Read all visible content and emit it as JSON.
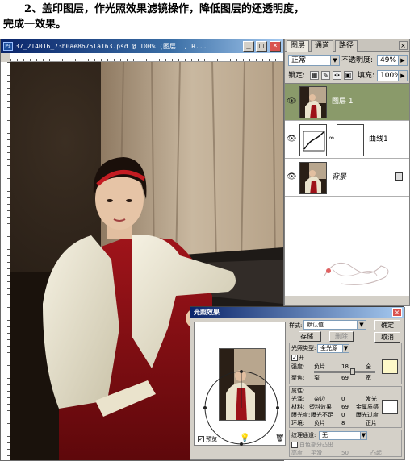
{
  "caption": {
    "line1": "2、盖印图层，作光照效果滤镜操作，降低图层的还透明度，",
    "line2": "完成一效果。"
  },
  "document": {
    "app_badge": "Ps",
    "title": "37_214016_73b0ae8675la163.psd @ 100% (图层 1, R...",
    "buttons": {
      "minimize": "_",
      "maximize": "□",
      "close": "×"
    }
  },
  "layers_panel": {
    "tabs": [
      "图层",
      "通道",
      "路径"
    ],
    "close": "×",
    "blend_mode": "正常",
    "opacity_label": "不透明度:",
    "opacity_value": "49%",
    "lock_label": "锁定:",
    "fill_label": "填充:",
    "fill_value": "100%",
    "layers": [
      {
        "name": "图层 1",
        "visible": true,
        "active": true
      },
      {
        "name": "曲线1",
        "visible": true,
        "active": false
      },
      {
        "name": "背景",
        "visible": true,
        "active": false,
        "locked": true
      }
    ]
  },
  "lighting_dialog": {
    "title": "光照效果",
    "style_label": "样式:",
    "style_value": "默认值",
    "save_button": "存储...",
    "delete_button": "删除",
    "ok_button": "确定",
    "cancel_button": "取消",
    "light_type_label": "光照类型:",
    "light_type_value": "全光源",
    "on_label": "开",
    "intensity_label": "强度:",
    "intensity_min": "负片",
    "intensity_value": "18",
    "intensity_max": "全",
    "focus_label": "聚焦:",
    "focus_min": "窄",
    "focus_value": "69",
    "focus_max": "宽",
    "properties_label": "属性:",
    "gloss_label": "光泽:",
    "gloss_min": "杂边",
    "gloss_value": "0",
    "gloss_max": "发光",
    "material_label": "材料:",
    "material_min": "塑料效果",
    "material_value": "69",
    "material_max": "金属质感",
    "exposure_label": "曝光度:",
    "exposure_min": "曝光不足",
    "exposure_value": "0",
    "exposure_max": "曝光过度",
    "ambience_label": "环境:",
    "ambience_min": "负片",
    "ambience_value": "8",
    "ambience_max": "正片",
    "texture_label": "纹理通道:",
    "texture_value": "无",
    "white_high_label": "白色部分凸出",
    "height_label": "高度",
    "height_min": "平滑",
    "height_value": "50",
    "height_max": "凸起",
    "preview_label": "预览",
    "light_color": "#fdf8c8",
    "property_color": "#ffffff"
  },
  "colors": {
    "active_layer": "#8a9a6a",
    "title_bar": "#0a246a",
    "dress": "#8b1012",
    "jacket": "#ece7d2"
  }
}
